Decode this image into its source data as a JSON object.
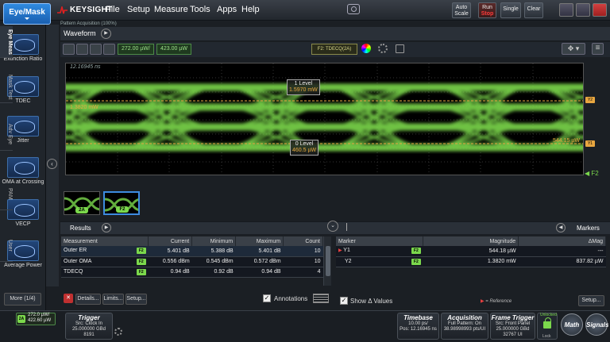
{
  "app": {
    "mode_label": "Eye/Mask",
    "brand": "KEYSIGHT",
    "menu": [
      "File",
      "Setup",
      "Measure",
      "Tools",
      "Apps",
      "Help"
    ],
    "buttons": {
      "auto_scale": [
        "Auto",
        "Scale"
      ],
      "run": "Run",
      "stop": "Stop",
      "single": "Single",
      "clear": "Clear"
    },
    "pattern_acquisition": "Pattern Acquisition (100%)"
  },
  "sidebar": {
    "items": [
      {
        "label": "Extinction Ratio",
        "icon": "extinction-ratio-icon"
      },
      {
        "label": "TDEC",
        "icon": "tdec-icon"
      },
      {
        "label": "Jitter",
        "icon": "jitter-icon"
      },
      {
        "label": "OMA at Crossing",
        "icon": "oma-crossing-icon"
      },
      {
        "label": "VECP",
        "icon": "vecp-icon"
      },
      {
        "label": "Average Power",
        "icon": "average-power-icon"
      }
    ],
    "more": "More (1/4)"
  },
  "vtabs": [
    "Eye Meas",
    "Mask Test",
    "Adv Eye",
    "PAM",
    "User"
  ],
  "waveform": {
    "tab": "Waveform",
    "scale": "272.00 µW/",
    "offset": "423.00 µW",
    "source_badge": "F2: TDECQ(2A)",
    "timestamp": "12.16945 ns",
    "one_level_title": "1 Level",
    "one_level_value": "1.5970 mW",
    "zero_level_title": "0 Level",
    "zero_level_value": "460.5 µW",
    "marker_y2": "1.3820 mW",
    "marker_y1": "544.15 µW",
    "func_label": "F2",
    "tag_y2": "Y2",
    "tag_y1": "Y1"
  },
  "thumbnails": [
    {
      "label": "2A"
    },
    {
      "label": "F2"
    }
  ],
  "results": {
    "title": "Results",
    "headers": [
      "Measurement",
      "Current",
      "Minimum",
      "Maximum",
      "Count"
    ],
    "rows": [
      {
        "name": "Outer ER",
        "src": "F2",
        "current": "5.401 dB",
        "min": "5.388 dB",
        "max": "5.401 dB",
        "count": "10"
      },
      {
        "name": "Outer OMA",
        "src": "F2",
        "current": "0.556 dBm",
        "min": "0.545 dBm",
        "max": "0.572 dBm",
        "count": "10"
      },
      {
        "name": "TDECQ",
        "src": "F2",
        "current": "0.94 dB",
        "min": "0.92 dB",
        "max": "0.94 dB",
        "count": "4"
      }
    ],
    "buttons": {
      "details": "Details...",
      "limits": "Limits...",
      "setup": "Setup..."
    },
    "annotations": "Annotations"
  },
  "markers": {
    "title": "Markers",
    "headers": [
      "Marker",
      "Magnitude",
      "ΔMag"
    ],
    "rows": [
      {
        "name": "Y1",
        "src": "F2",
        "magnitude": "544.18 µW",
        "delta": "---"
      },
      {
        "name": "Y2",
        "src": "F2",
        "magnitude": "1.3820 mW",
        "delta": "837.82 µW"
      }
    ],
    "show_delta": "Show Δ Values",
    "reference": "= Reference",
    "setup": "Setup..."
  },
  "status": {
    "channel_chip": "2A",
    "channel_scale": "272.0 µW/",
    "channel_offset": "422.60 µW",
    "trigger": {
      "title": "Trigger",
      "lines": [
        "Src: Clock In",
        "25.000000 GBd",
        "8191"
      ]
    },
    "timebase": {
      "title": "Timebase",
      "lines": [
        "10.00 ps/",
        "Pos: 12.16945 ns"
      ]
    },
    "acquisition": {
      "title": "Acquisition",
      "lines": [
        "Full Pattern: On",
        "38.98998993 pts/UI"
      ]
    },
    "frame_trigger": {
      "title": "Frame Trigger",
      "lines": [
        "Src: Front Panel",
        "25.000000 GBd",
        "32767 UI"
      ]
    },
    "unlocked": "Unlocked",
    "lock": "Lock",
    "math": "Math",
    "signals": "Signals"
  },
  "colors": {
    "trace": "#7bd84c",
    "accent": "#2f8ae0",
    "marker": "#e8a640"
  }
}
